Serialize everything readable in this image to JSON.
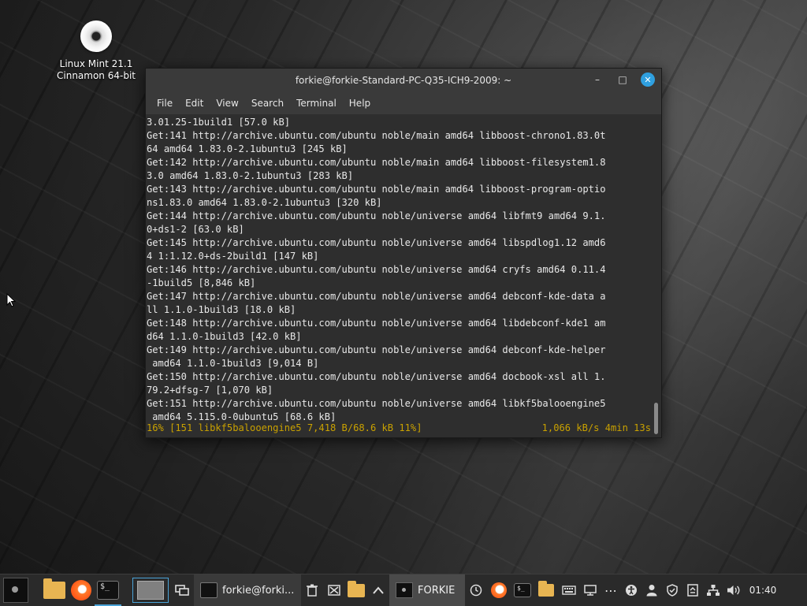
{
  "desktop": {
    "icon_label_line1": "Linux Mint 21.1",
    "icon_label_line2": "Cinnamon 64-bit"
  },
  "window": {
    "title": "forkie@forkie-Standard-PC-Q35-ICH9-2009: ~",
    "minimize_glyph": "–",
    "maximize_glyph": "□",
    "close_glyph": "✕",
    "menu": [
      "File",
      "Edit",
      "View",
      "Search",
      "Terminal",
      "Help"
    ]
  },
  "terminal": {
    "lines": [
      "3.01.25-1build1 [57.0 kB]",
      "Get:141 http://archive.ubuntu.com/ubuntu noble/main amd64 libboost-chrono1.83.0t",
      "64 amd64 1.83.0-2.1ubuntu3 [245 kB]",
      "Get:142 http://archive.ubuntu.com/ubuntu noble/main amd64 libboost-filesystem1.8",
      "3.0 amd64 1.83.0-2.1ubuntu3 [283 kB]",
      "Get:143 http://archive.ubuntu.com/ubuntu noble/main amd64 libboost-program-optio",
      "ns1.83.0 amd64 1.83.0-2.1ubuntu3 [320 kB]",
      "Get:144 http://archive.ubuntu.com/ubuntu noble/universe amd64 libfmt9 amd64 9.1.",
      "0+ds1-2 [63.0 kB]",
      "Get:145 http://archive.ubuntu.com/ubuntu noble/universe amd64 libspdlog1.12 amd6",
      "4 1:1.12.0+ds-2build1 [147 kB]",
      "Get:146 http://archive.ubuntu.com/ubuntu noble/universe amd64 cryfs amd64 0.11.4",
      "-1build5 [8,846 kB]",
      "Get:147 http://archive.ubuntu.com/ubuntu noble/universe amd64 debconf-kde-data a",
      "ll 1.1.0-1build3 [18.0 kB]",
      "Get:148 http://archive.ubuntu.com/ubuntu noble/universe amd64 libdebconf-kde1 am",
      "d64 1.1.0-1build3 [42.0 kB]",
      "Get:149 http://archive.ubuntu.com/ubuntu noble/universe amd64 debconf-kde-helper",
      " amd64 1.1.0-1build3 [9,014 B]",
      "Get:150 http://archive.ubuntu.com/ubuntu noble/universe amd64 docbook-xsl all 1.",
      "79.2+dfsg-7 [1,070 kB]",
      "Get:151 http://archive.ubuntu.com/ubuntu noble/universe amd64 libkf5balooengine5",
      " amd64 5.115.0-0ubuntu5 [68.6 kB]"
    ],
    "progress_left": "16% [151 libkf5balooengine5 7,418 B/68.6 kB 11%]",
    "progress_right": "1,066 kB/s 4min 13s",
    "progress_color": "#c9a100"
  },
  "taskbar": {
    "terminal_launcher_glyph": "$_",
    "task_terminal_label": "forkie@forki...",
    "task_forkie_label": "FORKIE",
    "clock": "01:40",
    "accent": "#4aa3d8"
  }
}
